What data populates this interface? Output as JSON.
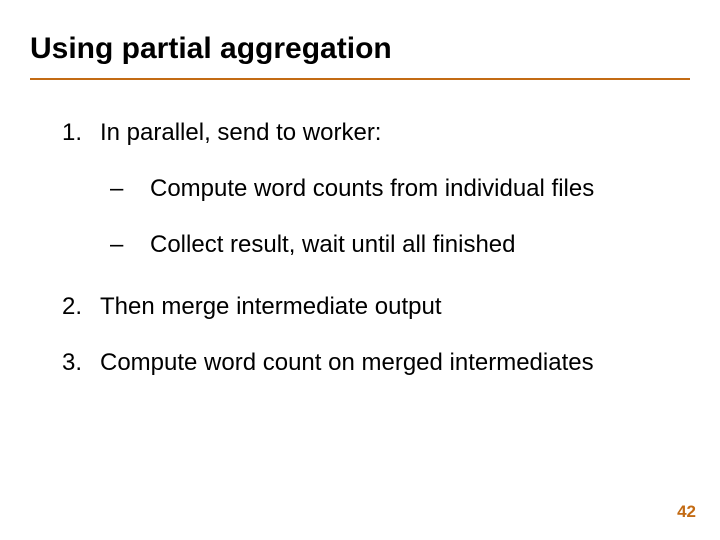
{
  "title": "Using partial aggregation",
  "items": {
    "n1": "1.",
    "t1": "In parallel, send to worker:",
    "d1a": "–",
    "s1a": "Compute word counts from individual files",
    "d1b": "–",
    "s1b": "Collect result, wait until all finished",
    "n2": "2.",
    "t2": "Then merge intermediate output",
    "n3": "3.",
    "t3": "Compute word count on merged intermediates"
  },
  "page": "42"
}
